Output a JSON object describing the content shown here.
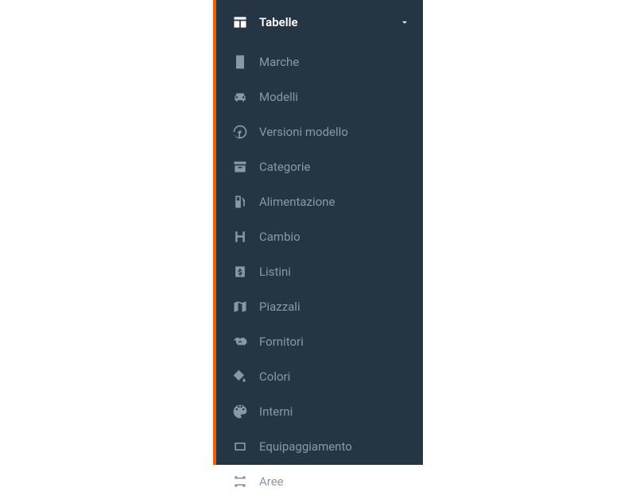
{
  "sidebar": {
    "header": {
      "label": "Tabelle"
    },
    "items": [
      {
        "label": "Marche"
      },
      {
        "label": "Modelli"
      },
      {
        "label": "Versioni modello"
      },
      {
        "label": "Categorie"
      },
      {
        "label": "Alimentazione"
      },
      {
        "label": "Cambio"
      },
      {
        "label": "Listini"
      },
      {
        "label": "Piazzali"
      },
      {
        "label": "Fornitori"
      },
      {
        "label": "Colori"
      },
      {
        "label": "Interni"
      },
      {
        "label": "Equipaggiamento"
      },
      {
        "label": "Aree"
      }
    ]
  }
}
